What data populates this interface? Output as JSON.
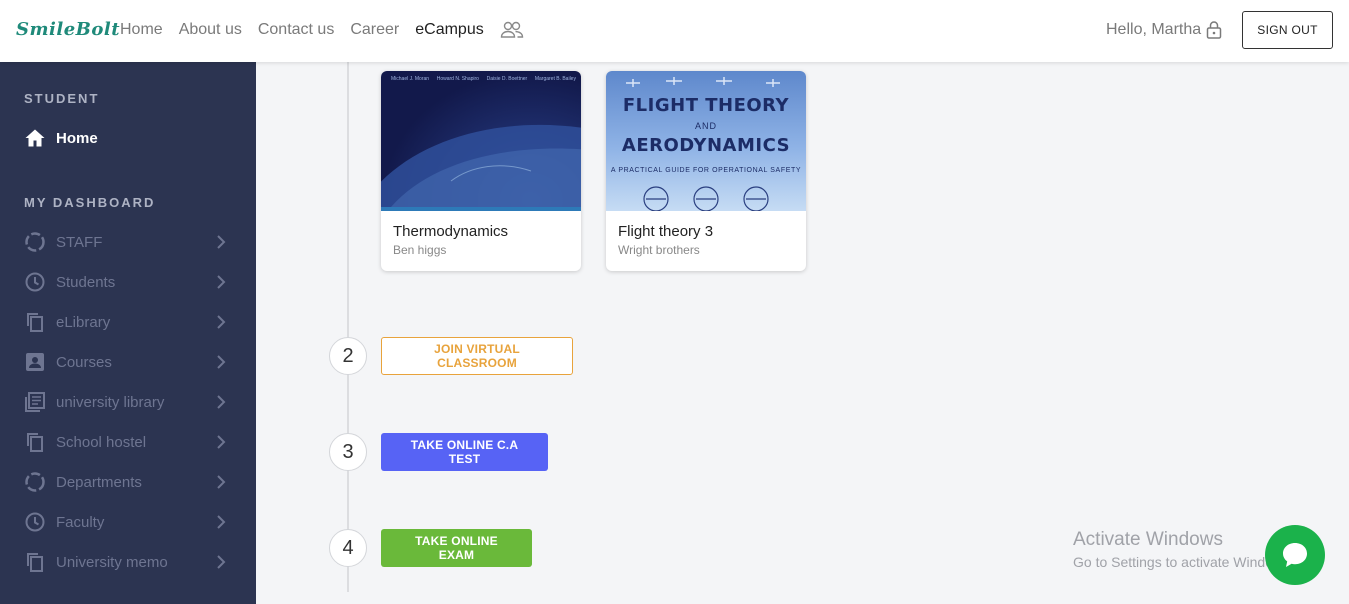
{
  "app": {
    "logo_text": "SmileBolt"
  },
  "nav": {
    "items": [
      "Home",
      "About us",
      "Contact us",
      "Career",
      "eCampus"
    ],
    "active": "eCampus"
  },
  "user": {
    "greeting": "Hello, Martha",
    "signout_label": "SIGN OUT"
  },
  "sidebar": {
    "student_section": "STUDENT",
    "home_label": "Home",
    "dashboard_section": "MY DASHBOARD",
    "items": [
      {
        "label": "STAFF",
        "icon": "circle-dashed-icon"
      },
      {
        "label": "Students",
        "icon": "clock-icon"
      },
      {
        "label": "eLibrary",
        "icon": "copy-icon"
      },
      {
        "label": "Courses",
        "icon": "account-box-icon"
      },
      {
        "label": "university library",
        "icon": "library-books-icon"
      },
      {
        "label": "School hostel",
        "icon": "copy-icon"
      },
      {
        "label": "Departments",
        "icon": "circle-dashed-icon"
      },
      {
        "label": "Faculty",
        "icon": "clock-icon"
      },
      {
        "label": "University memo",
        "icon": "copy-icon"
      }
    ]
  },
  "books": [
    {
      "title": "Thermodynamics",
      "author": "Ben higgs",
      "cover_authors": [
        "Michael J. Moran",
        "Howard N. Shapiro",
        "Daisie D. Boettner",
        "Margaret B. Bailey"
      ]
    },
    {
      "title": "Flight theory 3",
      "author": "Wright brothers",
      "cover_line1": "FLIGHT THEORY",
      "cover_line2": "AND",
      "cover_line3": "AERODYNAMICS",
      "cover_line4": "A PRACTICAL GUIDE FOR OPERATIONAL SAFETY"
    }
  ],
  "steps": [
    {
      "number": "2",
      "label": "JOIN VIRTUAL CLASSROOM"
    },
    {
      "number": "3",
      "label": "TAKE ONLINE C.A TEST"
    },
    {
      "number": "4",
      "label": "TAKE ONLINE EXAM"
    }
  ],
  "watermark": {
    "line1": "Activate Windows",
    "line2": "Go to Settings to activate Windows."
  },
  "colors": {
    "sidebar_bg": "#2c3451",
    "virtual_btn": "#e8a33c",
    "test_btn": "#5763f5",
    "exam_btn": "#6ab93a",
    "chat_btn": "#1bb24b"
  }
}
